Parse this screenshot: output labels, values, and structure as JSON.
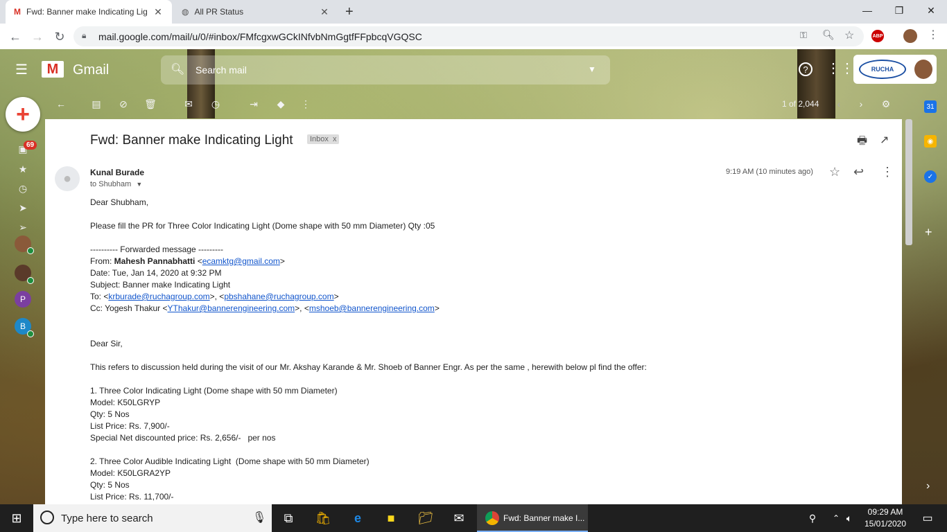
{
  "browser": {
    "tabs": [
      {
        "title": "Fwd: Banner make Indicating Lig"
      },
      {
        "title": "All PR Status"
      }
    ],
    "url": "mail.google.com/mail/u/0/#inbox/FMfcgxwGCkINfvbNmGgtfFFpbcqVGQSC"
  },
  "gmail": {
    "logo_text": "Gmail",
    "search_placeholder": "Search mail",
    "brand_logo_text": "RUCHA",
    "unread_badge": "69",
    "pager": "1 of 2,044",
    "rail_avatars": [
      "P",
      "B"
    ]
  },
  "email": {
    "subject": "Fwd: Banner make Indicating Light",
    "label": "Inbox",
    "label_close": "x",
    "sender": "Kunal Burade",
    "to": "to Shubham",
    "time": "9:19 AM (10 minutes ago)",
    "greeting": "Dear Shubham,",
    "request": "Please fill the PR for Three Color Indicating Light (Dome shape with 50 mm Diameter) Qty :05",
    "fwd_header": "---------- Forwarded message ---------",
    "from_label": "From: ",
    "from_name": "Mahesh Pannabhatti",
    "from_email": "ecamktg@gmail.com",
    "date": "Date: Tue, Jan 14, 2020 at 9:32 PM",
    "subject_line": "Subject: Banner make Indicating Light",
    "to_label": "To: <",
    "to_email1": "krburade@ruchagroup.com",
    "to_sep": ">, <",
    "to_email2": "pbshahane@ruchagroup.com",
    "to_end": ">",
    "cc_label": "Cc: Yogesh Thakur <",
    "cc_email1": "YThakur@bannerengineering.com",
    "cc_sep": ">, <",
    "cc_email2": "mshoeb@bannerengineering.com",
    "cc_end": ">",
    "body_greeting": "Dear Sir,",
    "body_intro": "This refers to discussion held during the visit of our Mr. Akshay Karande & Mr. Shoeb of Banner Engr. As per the same , herewith below pl find the offer:",
    "item1": [
      "1. Three Color Indicating Light (Dome shape with 50 mm Diameter)",
      "Model: K50LGRYP",
      "Qty: 5 Nos",
      "List Price: Rs. 7,900/-",
      "Special Net discounted price: Rs. 2,656/-   per nos"
    ],
    "item2": [
      "2. Three Color Audible Indicating Light  (Dome shape with 50 mm Diameter)",
      "Model: K50LGRA2YP",
      "Qty: 5 Nos",
      "List Price: Rs. 11,700/-"
    ]
  },
  "taskbar": {
    "search_placeholder": "Type here to search",
    "active_window": "Fwd: Banner make I...",
    "time": "09:29 AM",
    "date": "15/01/2020"
  }
}
